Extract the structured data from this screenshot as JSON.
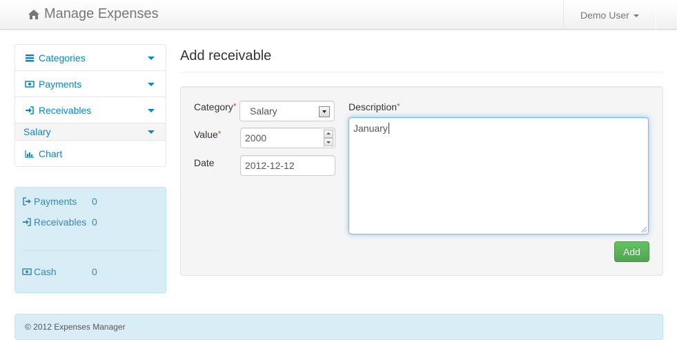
{
  "app": {
    "brand": "Manage Expenses",
    "user": "Demo User"
  },
  "sidebar": {
    "items": [
      {
        "label": "Categories",
        "icon": "list-icon"
      },
      {
        "label": "Payments",
        "icon": "money-icon"
      },
      {
        "label": "Receivables",
        "icon": "sign-in-icon"
      }
    ],
    "selected_sub": "Salary",
    "chart": "Chart"
  },
  "summary": {
    "payments_label": "Payments",
    "payments_value": "0",
    "receivables_label": "Receivables",
    "receivables_value": "0",
    "cash_label": "Cash",
    "cash_value": "0"
  },
  "page": {
    "title": "Add receivable"
  },
  "form": {
    "category_label": "Category",
    "category_value": "Salary",
    "value_label": "Value",
    "value_value": "2000",
    "date_label": "Date",
    "date_value": "2012-12-12",
    "description_label": "Description",
    "description_value": "January",
    "required_mark": "*",
    "add_button": "Add"
  },
  "footer": {
    "text": "© 2012 Expenses Manager"
  },
  "colors": {
    "link": "#0088cc",
    "info_bg": "#d9edf7",
    "success": "#5bb75b",
    "required": "#b94a48"
  }
}
